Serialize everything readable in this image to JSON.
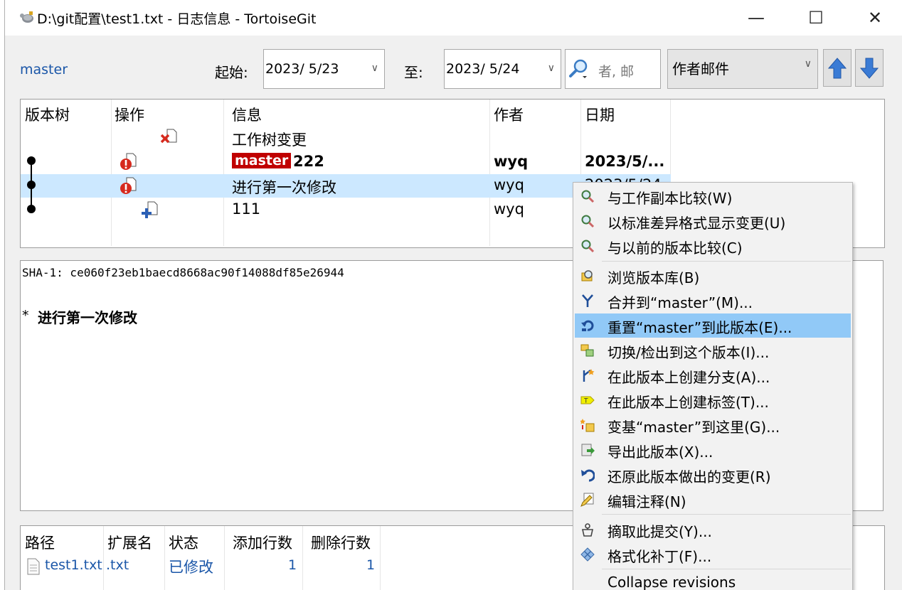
{
  "window": {
    "title": "D:\\git配置\\test1.txt - 日志信息 - TortoiseGit",
    "minimize_glyph": "—",
    "maximize_glyph": "☐",
    "close_glyph": "✕"
  },
  "toolbar": {
    "branch": "master",
    "from_label": "起始:",
    "from_date": "2023/ 5/23",
    "to_label": "至:",
    "to_date": "2023/ 5/24",
    "search_placeholder": "者, 邮",
    "filter_value": "作者邮件",
    "dropdown_glyph": "∨"
  },
  "log": {
    "columns": [
      "版本树",
      "操作",
      "信息",
      "作者",
      "日期"
    ],
    "rows": [
      {
        "message": "工作树变更",
        "author": "",
        "date": ""
      },
      {
        "branch_tag": "master",
        "message": "222",
        "author": "wyq",
        "date": "2023/5/..."
      },
      {
        "message": "进行第一次修改",
        "author": "wyq",
        "date": "2023/5/24"
      },
      {
        "message": "111",
        "author": "wyq",
        "date": ""
      }
    ]
  },
  "details": {
    "sha": "SHA-1: ce060f23eb1baecd8668ac90f14088df85e26944",
    "bullet": "*",
    "message": "进行第一次修改"
  },
  "files": {
    "columns": [
      "路径",
      "扩展名",
      "状态",
      "添加行数",
      "删除行数"
    ],
    "rows": [
      {
        "path": "test1.txt",
        "ext": ".txt",
        "status": "已修改",
        "added": "1",
        "deleted": "1"
      }
    ]
  },
  "context_menu": {
    "items": [
      {
        "label": "与工作副本比较(W)",
        "icon": "magnifier-icon"
      },
      {
        "label": "以标准差异格式显示变更(U)",
        "icon": "magnifier-icon"
      },
      {
        "label": "与以前的版本比较(C)",
        "icon": "magnifier-icon"
      },
      {
        "label": "浏览版本库(B)",
        "icon": "repo-browser-icon"
      },
      {
        "label": "合并到“master”(M)...",
        "icon": "merge-icon"
      },
      {
        "label": "重置“master”到此版本(E)...",
        "icon": "reset-icon"
      },
      {
        "label": "切换/检出到这个版本(I)...",
        "icon": "switch-icon"
      },
      {
        "label": "在此版本上创建分支(A)...",
        "icon": "branch-icon"
      },
      {
        "label": "在此版本上创建标签(T)...",
        "icon": "tag-icon"
      },
      {
        "label": "变基“master”到这里(G)...",
        "icon": "rebase-icon"
      },
      {
        "label": "导出此版本(X)...",
        "icon": "export-icon"
      },
      {
        "label": "还原此版本做出的变更(R)",
        "icon": "revert-icon"
      },
      {
        "label": "编辑注释(N)",
        "icon": "edit-notes-icon"
      },
      {
        "label": "摘取此提交(Y)...",
        "icon": "cherry-pick-icon"
      },
      {
        "label": "格式化补丁(F)...",
        "icon": "format-patch-icon"
      },
      {
        "label": "Collapse revisions",
        "icon": ""
      }
    ],
    "selected_index": 5
  },
  "colors": {
    "selection_row": "#cce8ff",
    "menu_highlight": "#91c9f7",
    "link_blue": "#1a56a8",
    "branch_tag_bg": "#c00000",
    "arrow_blue": "#3a7bd5"
  }
}
